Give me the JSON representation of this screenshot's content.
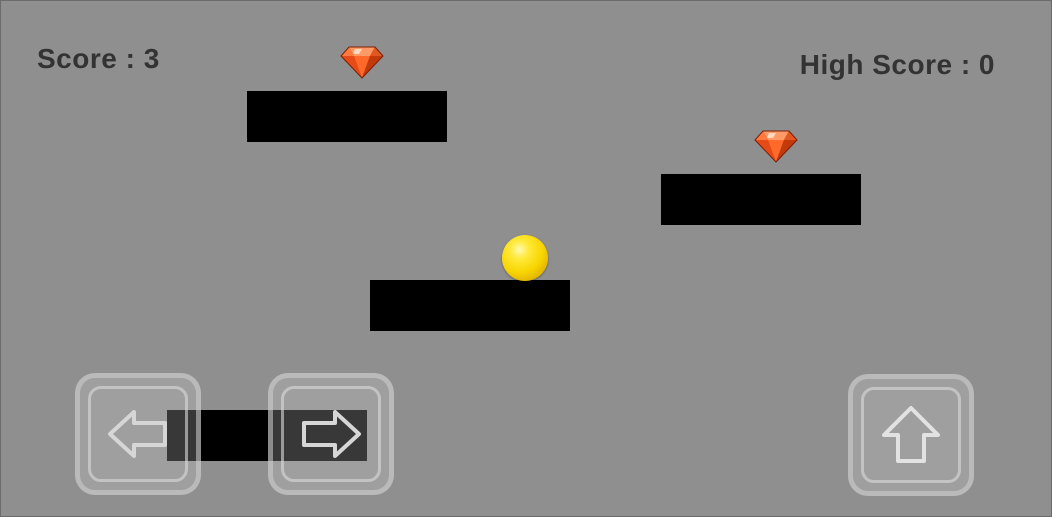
{
  "hud": {
    "score_text": "Score : 3",
    "high_score_text": "High Score : 0"
  },
  "game_state": {
    "score": 3,
    "high_score": 0
  },
  "colors": {
    "background": "#8f8f8f",
    "platform": "#000000",
    "ball": "#f8d400",
    "gem": "#e24a1a",
    "hud_text": "#333333"
  },
  "controls": {
    "left_icon": "left-arrow-icon",
    "right_icon": "right-arrow-icon",
    "jump_icon": "up-arrow-icon"
  }
}
